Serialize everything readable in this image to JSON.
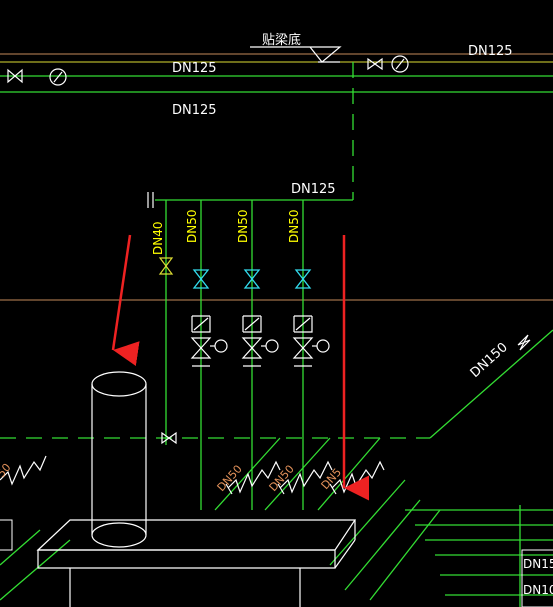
{
  "drawing": {
    "background": "#000000",
    "colors": {
      "pipe": "#33dd33",
      "label_white": "#ffffff",
      "label_yellow": "#ffff00",
      "label_orange": "#e0905a",
      "reference_line": "#c58a5a",
      "valve_cyan": "#33ddee",
      "arrow": "#ee2222"
    },
    "beam_note": "贴梁底",
    "labels": {
      "main_top_left": "DN125",
      "main_top_right": "DN125",
      "main_second": "DN125",
      "branch_header": "DN125",
      "riser_1": "DN40",
      "riser_2": "DN50",
      "riser_3": "DN50",
      "riser_4": "DN50",
      "diagonal_right": "DN150",
      "lower_1": "DN50",
      "lower_2": "DN50",
      "lower_3": "DN5",
      "lower_left": "50",
      "corner_1": "DN15",
      "corner_2": "DN10"
    }
  }
}
